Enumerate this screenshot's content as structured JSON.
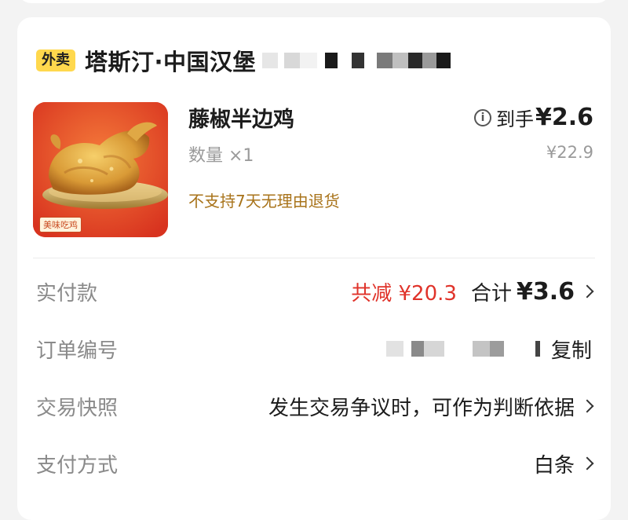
{
  "order": {
    "channel_tag": "外卖",
    "store_name": "塔斯汀·中国汉堡"
  },
  "product": {
    "name": "藤椒半边鸡",
    "quantity": "数量 ×1",
    "return_policy": "不支持7天无理由退货",
    "final_price_label": "到手",
    "final_price": "¥2.6",
    "original_price": "¥22.9",
    "image_badge": "美味吃鸡",
    "image_icon": "roast-chicken-icon"
  },
  "payment": {
    "label": "实付款",
    "discount": "共减 ¥20.3",
    "total_label": "合计",
    "total": "¥3.6"
  },
  "order_number": {
    "label": "订单编号",
    "copy_label": "复制"
  },
  "snapshot": {
    "label": "交易快照",
    "value": "发生交易争议时，可作为判断依据"
  },
  "pay_method": {
    "label": "支付方式",
    "value": "白条"
  },
  "colors": {
    "tag_bg": "#ffd84d",
    "discount": "#e0332a",
    "policy": "#a8731a"
  }
}
